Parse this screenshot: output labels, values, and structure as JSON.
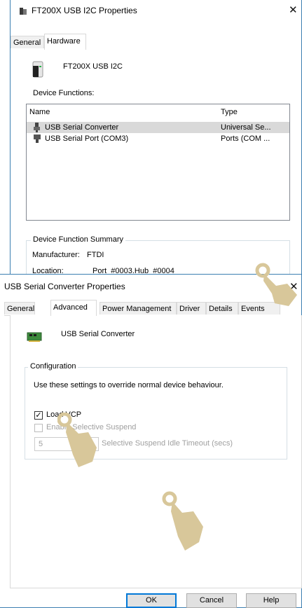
{
  "back_window": {
    "title": "FT200X USB I2C Properties",
    "tabs": [
      "General",
      "Hardware"
    ],
    "device_name": "FT200X USB I2C",
    "functions_label": "Device Functions:",
    "columns": [
      "Name",
      "Type"
    ],
    "rows": [
      {
        "name": "USB Serial Converter",
        "type": "Universal Se..."
      },
      {
        "name": "USB Serial Port (COM3)",
        "type": "Ports (COM ..."
      }
    ],
    "summary_legend": "Device Function Summary",
    "manufacturer_label": "Manufacturer:",
    "manufacturer_value": "FTDI",
    "location_label": "Location:",
    "location_value": "Port_#0003.Hub_#0004"
  },
  "front_window": {
    "title": "USB Serial Converter Properties",
    "tabs": [
      "General",
      "Advanced",
      "Power Management",
      "Driver",
      "Details",
      "Events"
    ],
    "device_name": "USB Serial Converter",
    "config_legend": "Configuration",
    "config_desc": "Use these settings to override normal device behaviour.",
    "load_vcp_label": "Load VCP",
    "load_vcp_checked": true,
    "selective_suspend_label": "Enable Selective Suspend",
    "timeout_value": "5",
    "timeout_label": "Selective Suspend Idle Timeout (secs)",
    "buttons": {
      "ok": "OK",
      "cancel": "Cancel",
      "help": "Help"
    }
  },
  "colors": {
    "accent": "#0078d7",
    "hand": "#d8c79a",
    "selection": "#d9d9d9"
  }
}
